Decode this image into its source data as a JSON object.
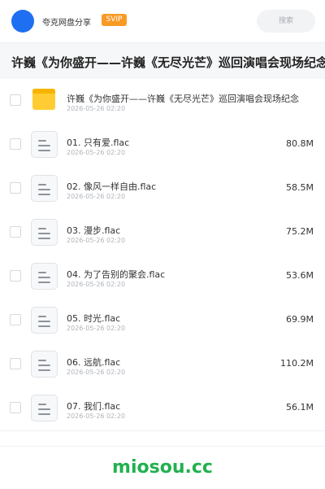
{
  "header": {
    "title": "夸克网盘分享",
    "badge": "SVIP",
    "search_placeholder": "搜索",
    "accent": "#1e6ff2",
    "badge_color": "#f99a26"
  },
  "folder": {
    "title": "许巍《为你盛开——许巍《无尽光芒》巡回演唱会现场纪念"
  },
  "items": [
    {
      "name": "许巍《为你盛开——许巍《无尽光芒》巡回演唱会现场纪念",
      "date": "2026-05-26 02:20",
      "size": "",
      "icon": "folder-icon"
    },
    {
      "name": "01. 只有爱.flac",
      "date": "2026-05-26 02:20",
      "size": "80.8M",
      "icon": "file-icon"
    },
    {
      "name": "02. 像风一样自由.flac",
      "date": "2026-05-26 02:20",
      "size": "58.5M",
      "icon": "file-icon"
    },
    {
      "name": "03. 漫步.flac",
      "date": "2026-05-26 02:20",
      "size": "75.2M",
      "icon": "file-icon"
    },
    {
      "name": "04. 为了告别的聚会.flac",
      "date": "2026-05-26 02:20",
      "size": "53.6M",
      "icon": "file-icon"
    },
    {
      "name": "05. 时光.flac",
      "date": "2026-05-26 02:20",
      "size": "69.9M",
      "icon": "file-icon"
    },
    {
      "name": "06. 远航.flac",
      "date": "2026-05-26 02:20",
      "size": "110.2M",
      "icon": "file-icon"
    },
    {
      "name": "07. 我们.flac",
      "date": "2026-05-26 02:20",
      "size": "56.1M",
      "icon": "file-icon"
    }
  ],
  "footer": {
    "brand": "miosou.cc",
    "brand_color": "#22b04f"
  }
}
